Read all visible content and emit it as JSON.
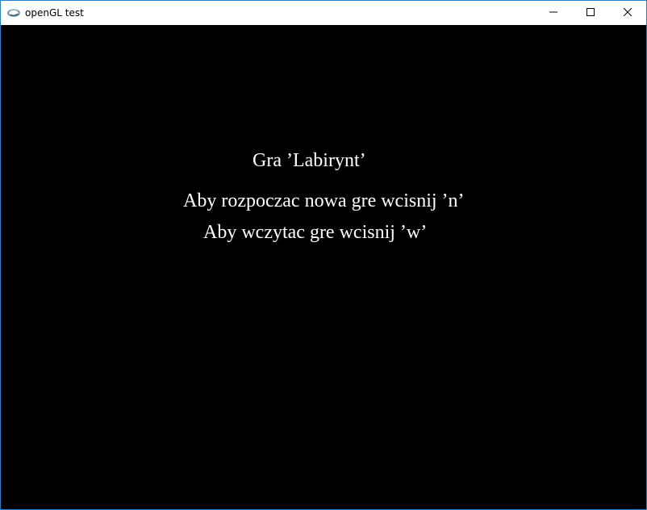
{
  "window": {
    "title": "openGL test",
    "app_icon": "opengl-swirl-icon",
    "buttons": [
      "minimize-icon",
      "maximize-icon",
      "close-icon"
    ],
    "frame_color": "#1883d7"
  },
  "game": {
    "background": "#000000",
    "text_color": "#ffffff",
    "title": "Gra ’Labirynt’",
    "new_game_prompt": "Aby rozpoczac nowa gre wcisnij ’n’",
    "load_game_prompt": "Aby wczytac gre wcisnij ’w’"
  }
}
